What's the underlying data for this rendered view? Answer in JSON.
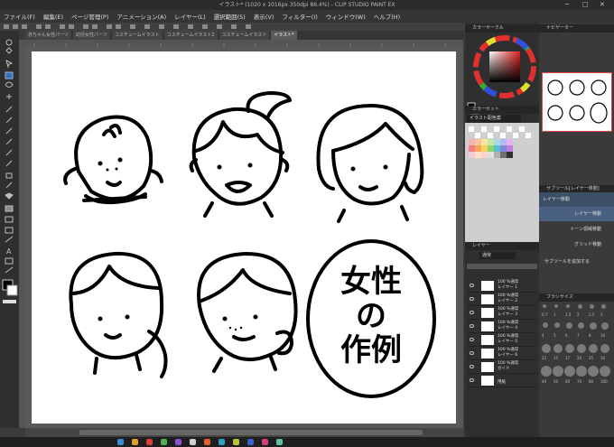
{
  "window": {
    "title": "イラスト* (1020 x 1016px 350dpi 86.4%) - CLIP STUDIO PAINT EX",
    "minimize": "─",
    "maximize": "□",
    "close": "✕"
  },
  "menu": [
    "ファイル(F)",
    "編集(E)",
    "ページ管理(P)",
    "アニメーション(A)",
    "レイヤー(L)",
    "選択範囲(S)",
    "表示(V)",
    "フィルター(I)",
    "ウィンドウ(W)",
    "ヘルプ(H)"
  ],
  "tabs": [
    {
      "label": "赤ちゃん女性パーツ"
    },
    {
      "label": "幼児女性パーツ"
    },
    {
      "label": "コスチュームイラスト"
    },
    {
      "label": "コスチュームイラスト2"
    },
    {
      "label": "コスチュームイラスト"
    },
    {
      "label": "イラスト*",
      "active": true
    }
  ],
  "artwork": {
    "text_lines": [
      "女性",
      "の",
      "作例"
    ]
  },
  "panels": {
    "color_wheel": {
      "header": "カラーサークル"
    },
    "navigator": {
      "header": "ナビゲーター"
    },
    "color_set": {
      "header": "カラーセット",
      "set_name": "イラスト配色案"
    },
    "layers": {
      "header": "レイヤー",
      "blend_mode": "通常",
      "rows": [
        {
          "line1": "100 %通常",
          "line2": "レイヤー 1"
        },
        {
          "line1": "100 %通常",
          "line2": "レイヤー 2"
        },
        {
          "line1": "100 %通常",
          "line2": "レイヤー 3"
        },
        {
          "line1": "100 %通常",
          "line2": "レイヤー 4"
        },
        {
          "line1": "100 %通常",
          "line2": "レイヤー 5"
        },
        {
          "line1": "100 %通常",
          "line2": "レイヤー 6"
        },
        {
          "line1": "100 %通常",
          "line2": "ガイド"
        },
        {
          "line1": "",
          "line2": "用紙"
        }
      ]
    },
    "subtool": {
      "header": "サブツール[レイヤー移動]",
      "items": [
        "レイヤー移動",
        "レイヤー移動",
        "トーン領域移動",
        "グリッド移動"
      ],
      "add_label": "サブツールを追加する"
    },
    "brush_size": {
      "header": "ブラシサイズ",
      "sizes": [
        "0.7",
        "1",
        "1.5",
        "2",
        "2.5",
        "3",
        "4",
        "5",
        "6",
        "7",
        "8",
        "10",
        "12",
        "15",
        "17",
        "20",
        "25",
        "30",
        "40",
        "50",
        "60",
        "70",
        "80",
        "100"
      ]
    }
  },
  "colors": {
    "main": "#000000",
    "sub": "#ffffff",
    "palette_active": "#d9d9d9"
  }
}
